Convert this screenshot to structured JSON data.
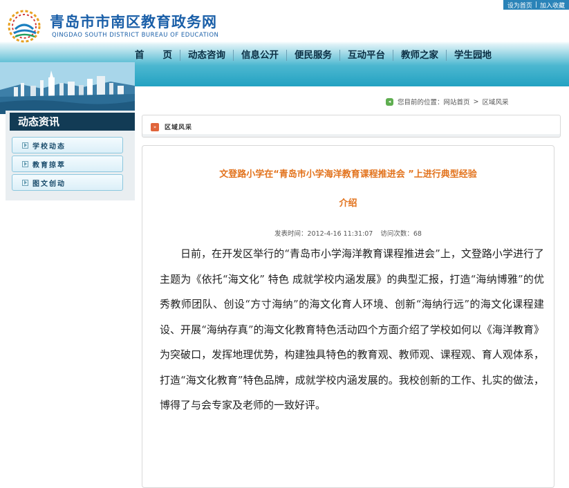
{
  "header": {
    "site_title": "青岛市市南区教育政务网",
    "site_subtitle": "QINGDAO SOUTH DISTRICT BUREAU OF EDUCATION",
    "top_links": [
      "设为首页",
      "加入收藏"
    ]
  },
  "nav": [
    "首　　页",
    "动态咨询",
    "信息公开",
    "便民服务",
    "互动平台",
    "教师之家",
    "学生园地"
  ],
  "sidebar": {
    "title": "动态资讯",
    "items": [
      "学校动态",
      "教育掠萃",
      "图文创动"
    ]
  },
  "breadcrumb": {
    "prefix": "您目前的位置：",
    "home": "网站首页",
    "separator": ">",
    "current": "区域风采"
  },
  "section": {
    "title": "区域风采"
  },
  "article": {
    "title_line1": "文登路小学在“青岛市小学海洋教育课程推进会 ”上进行典型经验",
    "title_line2": "介绍",
    "publish_label": "发表时间：2012-4-16 11:31:07",
    "visits_label": "访问次数：68",
    "body": "日前，在开发区举行的“青岛市小学海洋教育课程推进会”上，文登路小学进行了主题为《依托“海文化” 特色 成就学校内涵发展》的典型汇报，打造“海纳博雅”的优秀教师团队、创设“方寸海纳”的海文化育人环境、创新“海纳行远”的海文化课程建设、开展“海纳存真”的海文化教育特色活动四个方面介绍了学校如何以《海洋教育》为突破口，发挥地理优势，构建独具特色的教育观、教师观、课程观、育人观体系，打造“海文化教育”特色品牌，成就学校内涵发展的。我校创新的工作、扎实的做法，博得了与会专家及老师的一致好评。"
  },
  "colors": {
    "accent_blue": "#1a5fa8",
    "title_orange": "#e2721c",
    "sidebar_head": "#123b55"
  }
}
